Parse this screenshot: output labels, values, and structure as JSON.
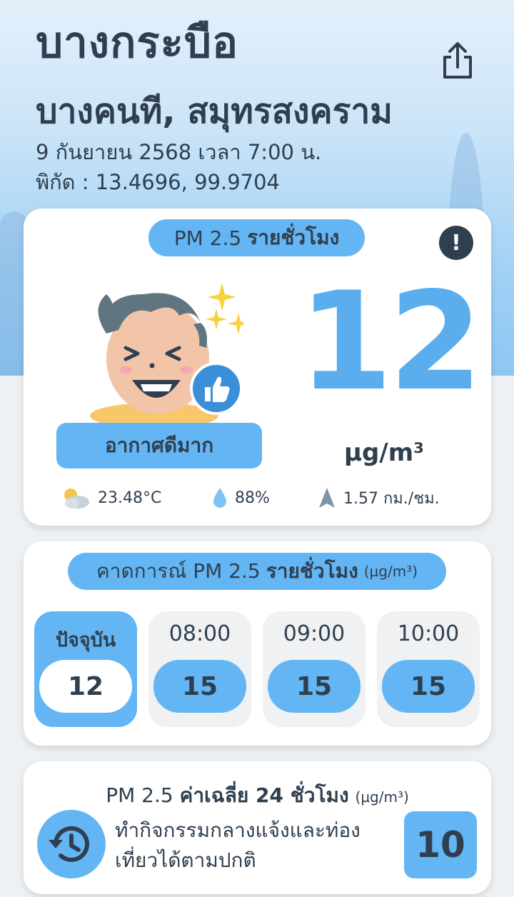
{
  "location": {
    "subdistrict": "บางกระบือ",
    "district_province": "บางคนที, สมุทรสงคราม",
    "datetime": "9 กันยายน 2568  เวลา 7:00 น.",
    "coordinates": "พิกัด : 13.4696, 99.9704"
  },
  "icons": {
    "share": "share-icon",
    "info": "info-icon",
    "weather": "partly-cloudy-icon",
    "humidity": "water-drop-icon",
    "wind": "wind-direction-icon",
    "history": "history-icon",
    "mascot": "happy-face-mascot",
    "thumbs_up": "thumbs-up-icon"
  },
  "colors": {
    "accent": "#64b5f3",
    "value": "#5aaeee",
    "text": "#2f3f4f"
  },
  "current": {
    "title_prefix": "PM 2.5",
    "title_bold": "รายชั่วโมง",
    "info_glyph": "!",
    "value": "12",
    "unit": "µg/m³",
    "status": "อากาศดีมาก",
    "temperature": "23.48°C",
    "humidity": "88%",
    "wind": "1.57 กม./ชม."
  },
  "forecast": {
    "title_prefix": "คาดการณ์ PM 2.5",
    "title_bold": "รายชั่วโมง",
    "unit": "(µg/m³)",
    "items": [
      {
        "time": "ปัจจุบัน",
        "value": "12",
        "current": true
      },
      {
        "time": "08:00",
        "value": "15",
        "current": false
      },
      {
        "time": "09:00",
        "value": "15",
        "current": false
      },
      {
        "time": "10:00",
        "value": "15",
        "current": false
      }
    ]
  },
  "average": {
    "title_prefix": "PM 2.5",
    "title_bold": "ค่าเฉลี่ย 24 ชั่วโมง",
    "unit": "(µg/m³)",
    "advice": "ทำกิจกรรมกลางแจ้งและท่องเที่ยวได้ตามปกติ",
    "value": "10"
  }
}
